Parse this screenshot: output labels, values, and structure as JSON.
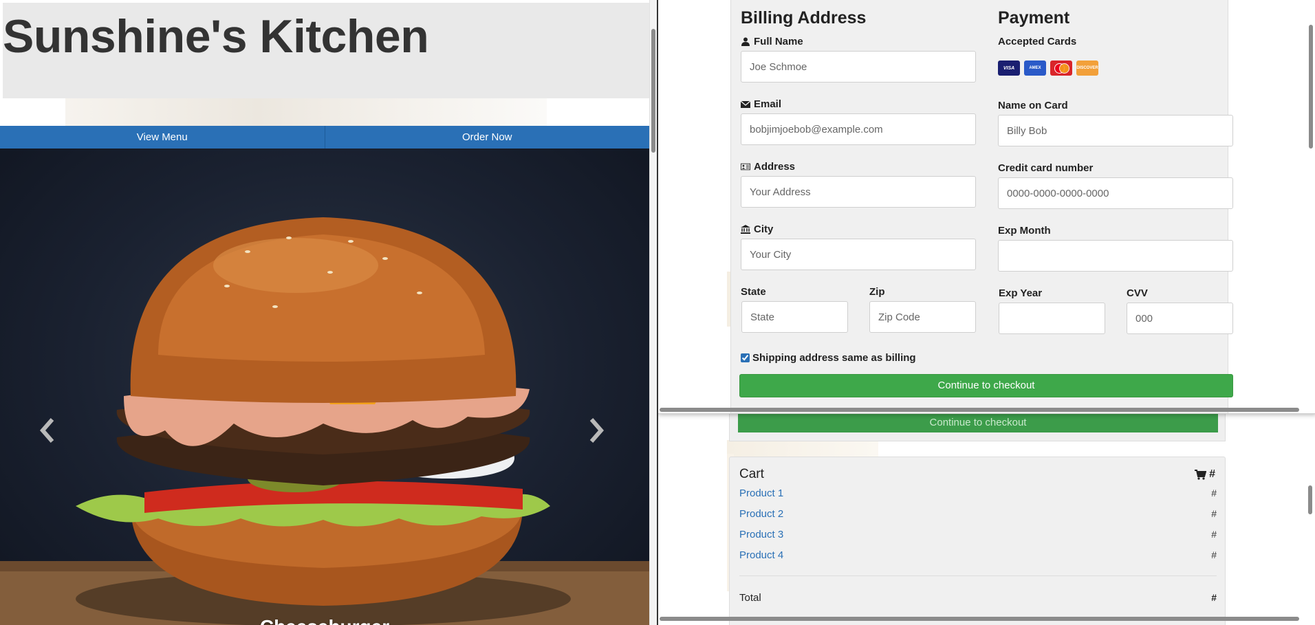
{
  "site": {
    "title": "Sunshine's Kitchen"
  },
  "nav": {
    "view_menu": "View Menu",
    "order_now": "Order Now"
  },
  "carousel": {
    "caption": "Cheeseburger"
  },
  "billing": {
    "title": "Billing Address",
    "full_name": {
      "label": "Full Name",
      "placeholder": "Joe Schmoe"
    },
    "email": {
      "label": "Email",
      "placeholder": "bobjimjoebob@example.com"
    },
    "address": {
      "label": "Address",
      "placeholder": "Your Address"
    },
    "city": {
      "label": "City",
      "placeholder": "Your City"
    },
    "state": {
      "label": "State",
      "placeholder": "State"
    },
    "zip": {
      "label": "Zip",
      "placeholder": "Zip Code"
    }
  },
  "payment": {
    "title": "Payment",
    "accepted_cards_label": "Accepted Cards",
    "cards": [
      {
        "name": "visa-card-icon",
        "text": "VISA"
      },
      {
        "name": "amex-card-icon",
        "text": "AMEX"
      },
      {
        "name": "mastercard-icon",
        "text": ""
      },
      {
        "name": "discover-card-icon",
        "text": "DISCOVER"
      }
    ],
    "name_on_card": {
      "label": "Name on Card",
      "placeholder": "Billy Bob"
    },
    "card_number": {
      "label": "Credit card number",
      "placeholder": "0000-0000-0000-0000"
    },
    "exp_month": {
      "label": "Exp Month",
      "placeholder": ""
    },
    "exp_year": {
      "label": "Exp Year",
      "placeholder": ""
    },
    "cvv": {
      "label": "CVV",
      "placeholder": "000"
    }
  },
  "checkbox": {
    "label": "Shipping address same as billing",
    "checked": true
  },
  "checkout": {
    "label": "Continue to checkout"
  },
  "cart": {
    "title": "Cart",
    "count": "#",
    "items": [
      {
        "name": "Product 1",
        "price": "#"
      },
      {
        "name": "Product 2",
        "price": "#"
      },
      {
        "name": "Product 3",
        "price": "#"
      },
      {
        "name": "Product 4",
        "price": "#"
      }
    ],
    "total_label": "Total",
    "total_value": "#"
  },
  "colors": {
    "nav_blue": "#2a70b6",
    "checkout_green": "#3ea84a",
    "panel_gray": "#f0f0f0"
  }
}
